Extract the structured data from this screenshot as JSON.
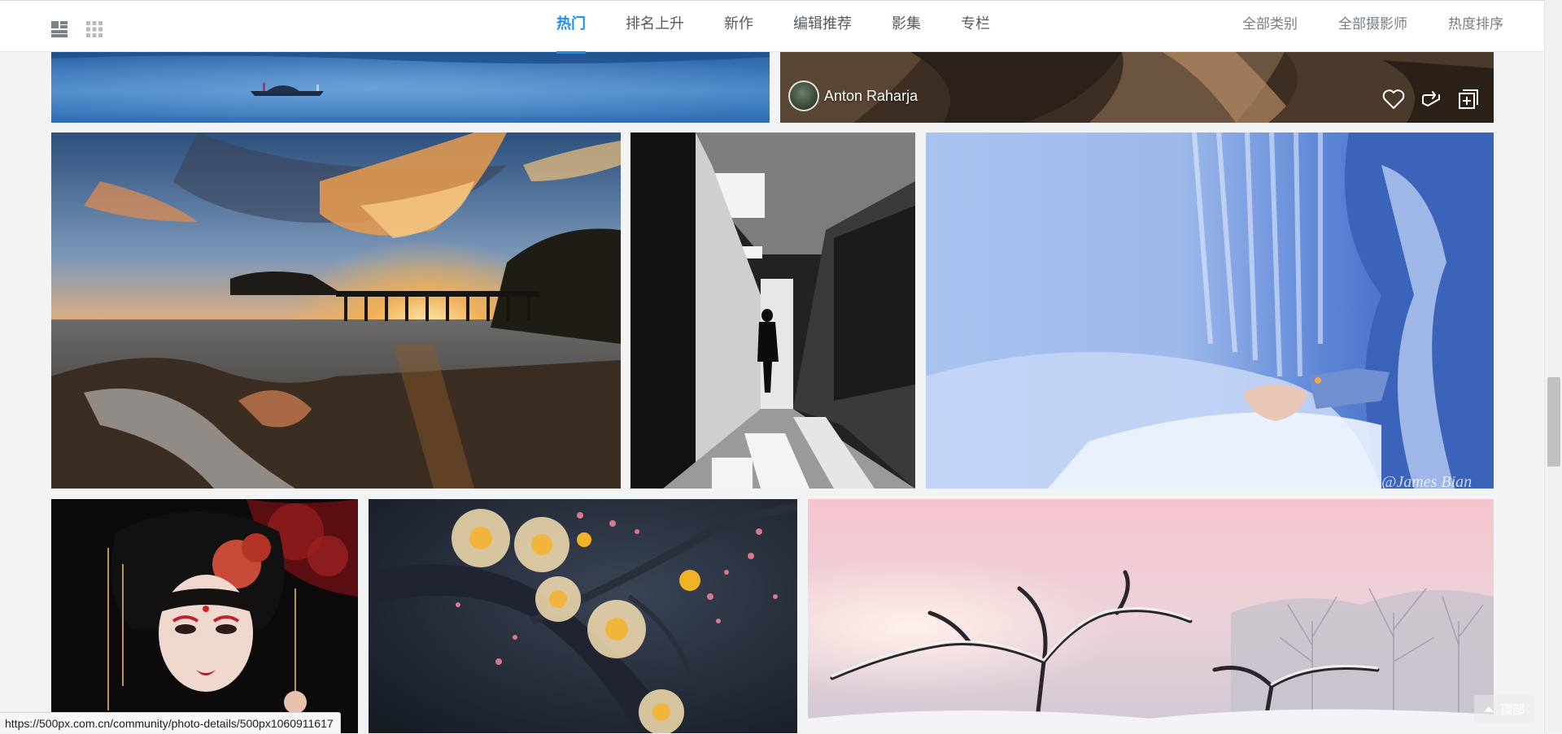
{
  "nav": {
    "view_modes": [
      {
        "icon": "list-view-icon",
        "active": true
      },
      {
        "icon": "grid-view-icon",
        "active": false
      }
    ],
    "tabs": [
      {
        "label": "热门",
        "active": true
      },
      {
        "label": "排名上升",
        "active": false
      },
      {
        "label": "新作",
        "active": false
      },
      {
        "label": "编辑推荐",
        "active": false
      },
      {
        "label": "影集",
        "active": false
      },
      {
        "label": "专栏",
        "active": false
      }
    ],
    "filters": [
      {
        "label": "全部类别"
      },
      {
        "label": "全部摄影师"
      },
      {
        "label": "热度排序"
      }
    ],
    "accent_color": "#1f8fe5"
  },
  "photos": {
    "featured": {
      "author": "Anton Raharja",
      "actions": [
        "like-icon",
        "share-icon",
        "add-to-gallery-icon"
      ]
    },
    "watermark": "@James Bian"
  },
  "status_bar": {
    "url": "https://500px.com.cn/community/photo-details/500px1060911617"
  },
  "back_to_top": {
    "label": "顶部"
  }
}
